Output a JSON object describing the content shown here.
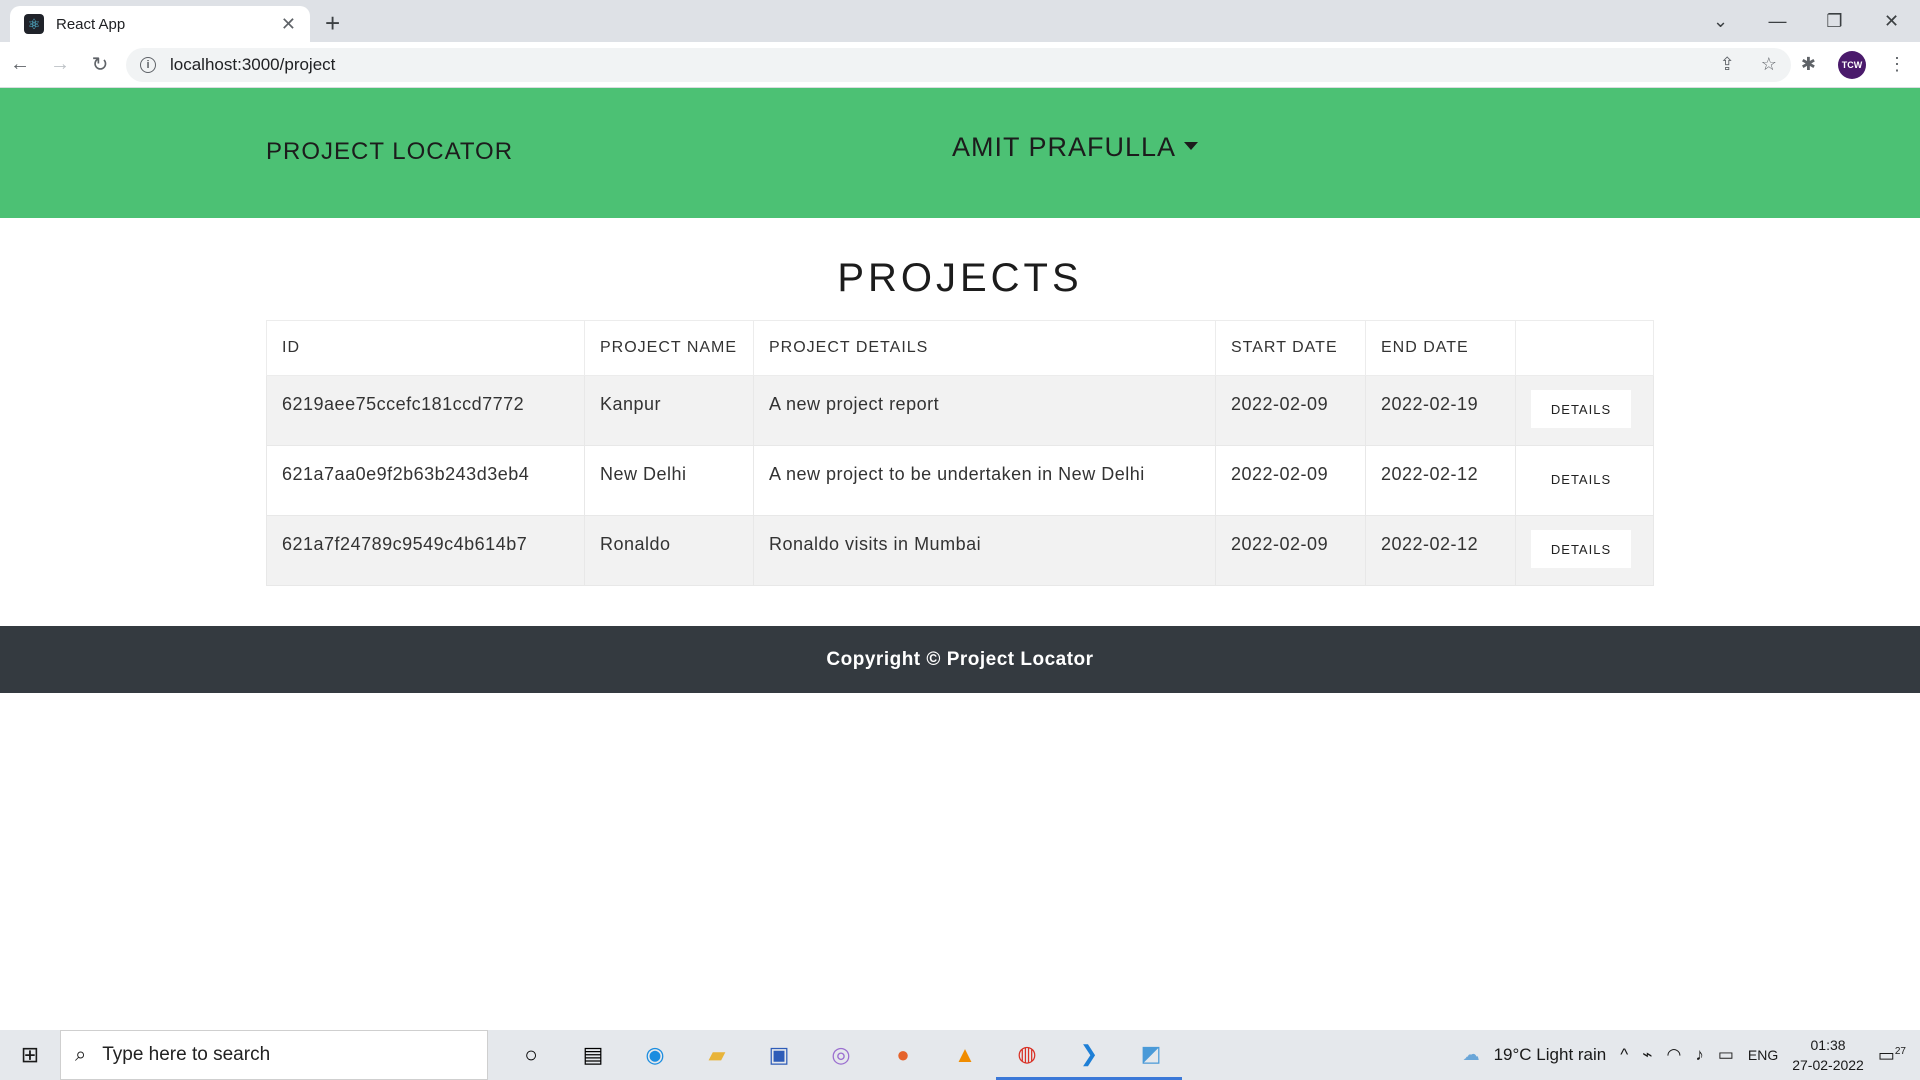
{
  "browser": {
    "tab_title": "React App",
    "tab_close": "✕",
    "new_tab": "+",
    "url": "localhost:3000/project",
    "window_controls": [
      "⌄",
      "—",
      "❐",
      "✕"
    ],
    "profile_initials": "TCW"
  },
  "app": {
    "brand": "PROJECT LOCATOR",
    "user_name": "AMIT PRAFULLA",
    "page_title": "PROJECTS",
    "table": {
      "headers": [
        "ID",
        "PROJECT NAME",
        "PROJECT DETAILS",
        "START DATE",
        "END DATE",
        ""
      ],
      "rows": [
        {
          "id": "6219aee75ccefc181ccd7772",
          "name": "Kanpur",
          "details": "A new project report",
          "start": "2022-02-09",
          "end": "2022-02-19",
          "action": "DETAILS"
        },
        {
          "id": "621a7aa0e9f2b63b243d3eb4",
          "name": "New Delhi",
          "details": "A new project to be undertaken in New Delhi",
          "start": "2022-02-09",
          "end": "2022-02-12",
          "action": "DETAILS"
        },
        {
          "id": "621a7f24789c9549c4b614b7",
          "name": "Ronaldo",
          "details": "Ronaldo visits in Mumbai",
          "start": "2022-02-09",
          "end": "2022-02-12",
          "action": "DETAILS"
        }
      ]
    },
    "footer": "Copyright © Project Locator"
  },
  "taskbar": {
    "search_placeholder": "Type here to search",
    "weather": "19°C  Light rain",
    "language": "ENG",
    "time": "01:38",
    "date": "27-02-2022",
    "notifications": "27"
  },
  "colors": {
    "header_bg": "#4cc174",
    "footer_bg": "#343a40"
  }
}
